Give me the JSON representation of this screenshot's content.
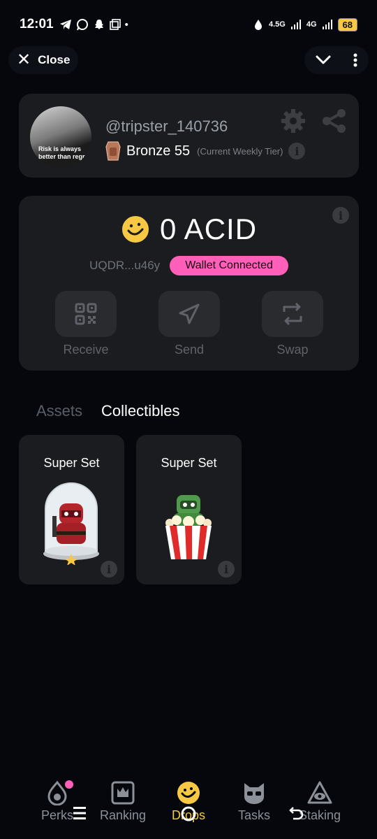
{
  "status_bar": {
    "time": "12:01",
    "network_a": "4.5G",
    "network_b": "4G",
    "battery": "68"
  },
  "topbar": {
    "close_label": "Close"
  },
  "profile": {
    "username": "@tripster_140736",
    "tier_name": "Bronze 55",
    "tier_note": "(Current Weekly Tier)",
    "avatar_caption_line1": "Risk is always",
    "avatar_caption_line2": "better than regret"
  },
  "wallet": {
    "balance": "0 ACID",
    "address": "UQDR...u46y",
    "status": "Wallet Connected",
    "actions": [
      {
        "label": "Receive",
        "icon": "qr-code-icon"
      },
      {
        "label": "Send",
        "icon": "send-icon"
      },
      {
        "label": "Swap",
        "icon": "swap-icon"
      }
    ]
  },
  "tabs": {
    "assets": "Assets",
    "collectibles": "Collectibles"
  },
  "collectibles": [
    {
      "title": "Super Set",
      "art": "red-ninja-dome-icon"
    },
    {
      "title": "Super Set",
      "art": "green-popcorn-icon"
    }
  ],
  "nav": [
    {
      "label": "Perks",
      "icon": "flame-icon"
    },
    {
      "label": "Ranking",
      "icon": "crown-icon"
    },
    {
      "label": "Drops",
      "icon": "smiley-coin-icon"
    },
    {
      "label": "Tasks",
      "icon": "cat-mask-icon"
    },
    {
      "label": "Staking",
      "icon": "eye-triangle-icon"
    }
  ],
  "colors": {
    "background": "#05070c",
    "card": "#1b1c1f",
    "accent_pink": "#ff5fb8",
    "accent_yellow": "#f6c843"
  }
}
